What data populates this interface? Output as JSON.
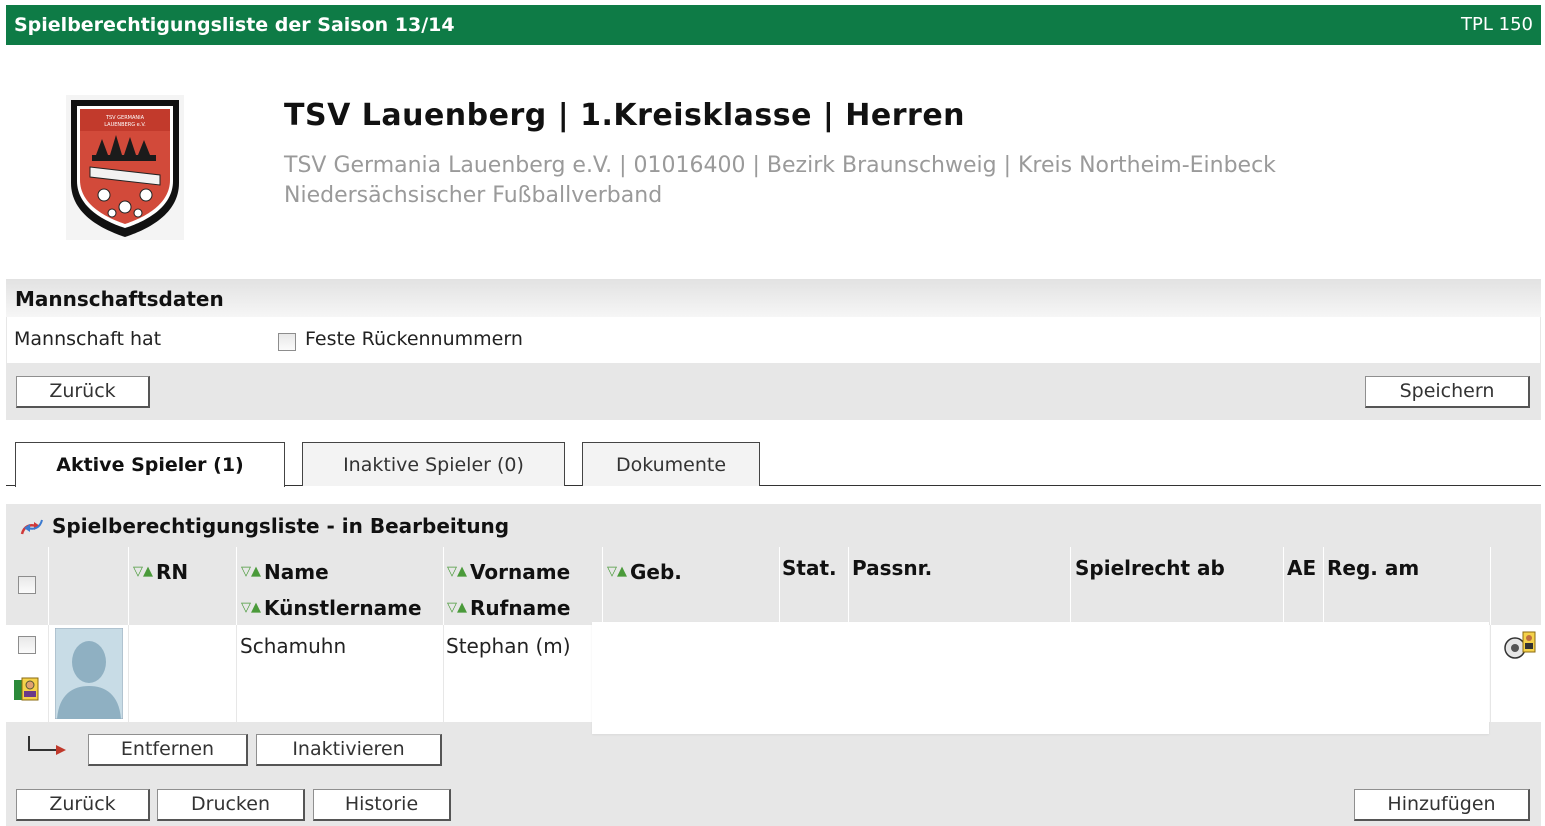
{
  "header": {
    "title": "Spielberechtigungsliste der Saison 13/14",
    "code": "TPL 150"
  },
  "team": {
    "title": "TSV Lauenberg | 1.Kreisklasse | Herren",
    "subtitle_line1": "TSV Germania Lauenberg e.V. | 01016400 | Bezirk Braunschweig | Kreis Northeim-Einbeck",
    "subtitle_line2": "Niedersächsischer Fußballverband"
  },
  "mannschaftsdaten": {
    "heading": "Mannschaftsdaten",
    "row_label": "Mannschaft hat",
    "checkbox_label": "Feste Rückennummern",
    "back_button": "Zurück",
    "save_button": "Speichern"
  },
  "tabs": [
    {
      "label": "Aktive Spieler (1)",
      "active": true
    },
    {
      "label": "Inaktive Spieler (0)",
      "active": false
    },
    {
      "label": "Dokumente",
      "active": false
    }
  ],
  "list": {
    "title": "Spielberechtigungsliste - in Bearbeitung",
    "columns": {
      "rn": "RN",
      "name": "Name",
      "kuenstlername": "Künstlername",
      "vorname": "Vorname",
      "rufname": "Rufname",
      "geb": "Geb.",
      "stat": "Stat.",
      "passnr": "Passnr.",
      "spielrecht": "Spielrecht ab",
      "ae": "AE",
      "reg": "Reg. am"
    },
    "rows": [
      {
        "name": "Schamuhn",
        "vorname": "Stephan (m)"
      }
    ],
    "action_buttons": {
      "remove": "Entfernen",
      "deactivate": "Inaktivieren"
    },
    "footer_buttons": {
      "back": "Zurück",
      "print": "Drucken",
      "history": "Historie",
      "add": "Hinzufügen"
    }
  }
}
